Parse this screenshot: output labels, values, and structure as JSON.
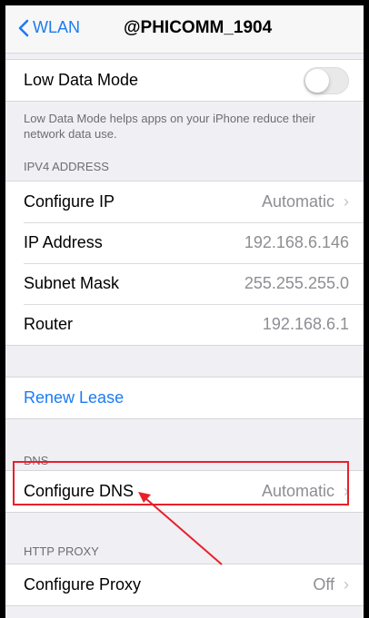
{
  "nav": {
    "back_label": "WLAN",
    "title": "@PHICOMM_1904"
  },
  "low_data": {
    "label": "Low Data Mode",
    "enabled": false,
    "footnote": "Low Data Mode helps apps on your iPhone reduce their network data use."
  },
  "ipv4": {
    "header": "IPV4 ADDRESS",
    "rows": [
      {
        "label": "Configure IP",
        "value": "Automatic",
        "chevron": true
      },
      {
        "label": "IP Address",
        "value": "192.168.6.146",
        "chevron": false
      },
      {
        "label": "Subnet Mask",
        "value": "255.255.255.0",
        "chevron": false
      },
      {
        "label": "Router",
        "value": "192.168.6.1",
        "chevron": false
      }
    ]
  },
  "renew": {
    "label": "Renew Lease"
  },
  "dns": {
    "header": "DNS",
    "configure_label": "Configure DNS",
    "configure_value": "Automatic"
  },
  "proxy": {
    "header": "HTTP PROXY",
    "configure_label": "Configure Proxy",
    "configure_value": "Off"
  },
  "colors": {
    "accent": "#1a7cf2",
    "annotation": "#e8202a"
  }
}
